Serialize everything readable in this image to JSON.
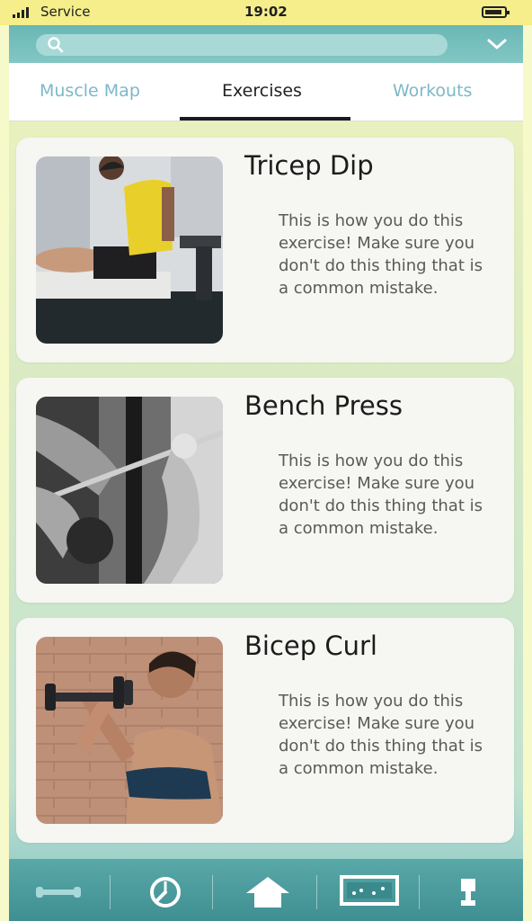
{
  "status_bar": {
    "carrier": "Service",
    "time": "19:02"
  },
  "search": {
    "icon": "search-icon",
    "dropdown_icon": "chevron-down-icon"
  },
  "tabs": [
    {
      "label": "Muscle Map",
      "active": false
    },
    {
      "label": "Exercises",
      "active": true
    },
    {
      "label": "Workouts",
      "active": false
    }
  ],
  "exercises": [
    {
      "title": "Tricep Dip",
      "description": "This is how you do this exercise! Make sure you don't do this thing that is a common mistake."
    },
    {
      "title": "Bench Press",
      "description": "This is how you do this exercise! Make sure you don't do this thing that is a common mistake."
    },
    {
      "title": "Bicep Curl",
      "description": "This is how you do this exercise! Make sure you don't do this thing that is a common mistake."
    }
  ],
  "bottom_nav": [
    {
      "icon": "dumbbell-icon"
    },
    {
      "icon": "timer-icon"
    },
    {
      "icon": "home-icon"
    },
    {
      "icon": "scoreboard-icon"
    },
    {
      "icon": "trophy-icon"
    }
  ],
  "colors": {
    "accent_teal": "#6ab7b6",
    "status_bar": "#f5ee8a",
    "inactive_tab": "#7cb8c8"
  }
}
